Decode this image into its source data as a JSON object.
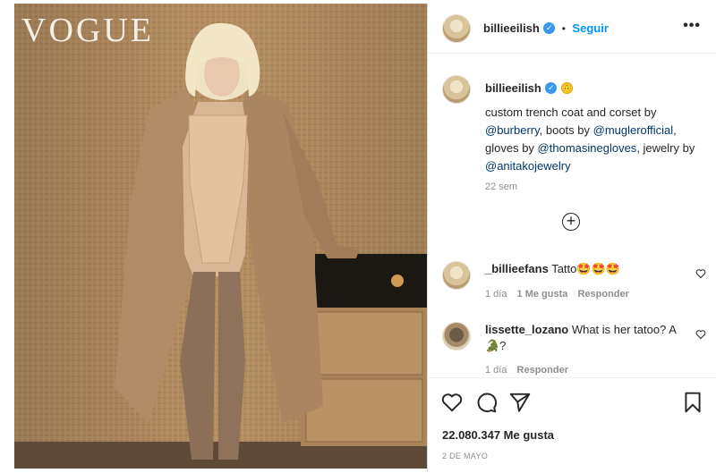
{
  "post": {
    "image_watermark": "VOGUE"
  },
  "header": {
    "username": "billieeilish",
    "separator": "•",
    "follow_label": "Seguir",
    "more_label": "•••"
  },
  "caption": {
    "username": "billieeilish",
    "emoji": "🙃",
    "text_1": "custom trench coat and corset by ",
    "mention_1": "@burberry",
    "text_2": ", boots by ",
    "mention_2": "@muglerofficial",
    "text_3": ", gloves by ",
    "mention_3": "@thomasinegloves",
    "text_4": ", jewelry by ",
    "mention_4": "@anitakojewelry",
    "time": "22 sem",
    "load_more": "+"
  },
  "comments": [
    {
      "username": "_billieefans",
      "text": "Tatto🤩🤩🤩",
      "time": "1 día",
      "likes": "1 Me gusta",
      "reply": "Responder"
    },
    {
      "username": "lissette_lozano",
      "text": "What is her tatoo? A 🐊?",
      "time": "1 día",
      "reply": "Responder"
    }
  ],
  "footer": {
    "likes": "22.080.347 Me gusta",
    "date": "2 DE MAYO"
  },
  "icons": {
    "like": "heart-icon",
    "comment": "comment-icon",
    "share": "share-icon",
    "save": "bookmark-icon",
    "verified": "verified-icon",
    "comment_like": "small-heart-icon"
  },
  "colors": {
    "link": "#00376b",
    "follow": "#0095f6",
    "verified": "#3897f0",
    "muted": "#8e8e8e"
  }
}
